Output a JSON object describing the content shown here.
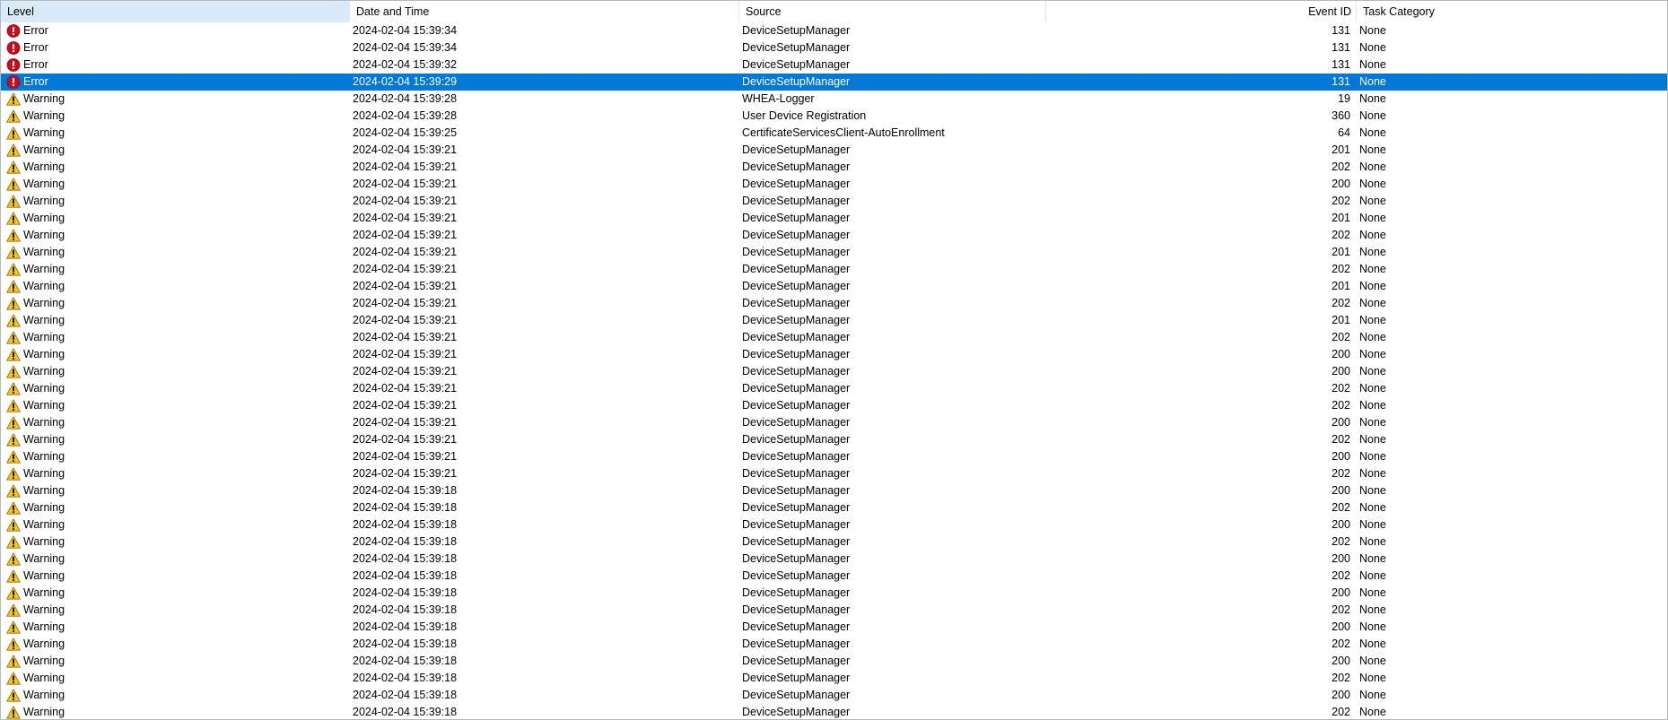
{
  "columns": {
    "level": "Level",
    "date": "Date and Time",
    "source": "Source",
    "event_id": "Event ID",
    "task": "Task Category"
  },
  "colors": {
    "selection": "#0078d7",
    "sorted_header": "#d9ebf9",
    "error_icon": "#c50f1f",
    "warning_icon": "#f7c325"
  },
  "selected_index": 3,
  "rows": [
    {
      "level": "Error",
      "icon": "error-icon",
      "date": "2024-02-04 15:39:34",
      "source": "DeviceSetupManager",
      "event_id": "131",
      "task": "None"
    },
    {
      "level": "Error",
      "icon": "error-icon",
      "date": "2024-02-04 15:39:34",
      "source": "DeviceSetupManager",
      "event_id": "131",
      "task": "None"
    },
    {
      "level": "Error",
      "icon": "error-icon",
      "date": "2024-02-04 15:39:32",
      "source": "DeviceSetupManager",
      "event_id": "131",
      "task": "None"
    },
    {
      "level": "Error",
      "icon": "error-icon",
      "date": "2024-02-04 15:39:29",
      "source": "DeviceSetupManager",
      "event_id": "131",
      "task": "None"
    },
    {
      "level": "Warning",
      "icon": "warning-icon",
      "date": "2024-02-04 15:39:28",
      "source": "WHEA-Logger",
      "event_id": "19",
      "task": "None"
    },
    {
      "level": "Warning",
      "icon": "warning-icon",
      "date": "2024-02-04 15:39:28",
      "source": "User Device Registration",
      "event_id": "360",
      "task": "None"
    },
    {
      "level": "Warning",
      "icon": "warning-icon",
      "date": "2024-02-04 15:39:25",
      "source": "CertificateServicesClient-AutoEnrollment",
      "event_id": "64",
      "task": "None"
    },
    {
      "level": "Warning",
      "icon": "warning-icon",
      "date": "2024-02-04 15:39:21",
      "source": "DeviceSetupManager",
      "event_id": "201",
      "task": "None"
    },
    {
      "level": "Warning",
      "icon": "warning-icon",
      "date": "2024-02-04 15:39:21",
      "source": "DeviceSetupManager",
      "event_id": "202",
      "task": "None"
    },
    {
      "level": "Warning",
      "icon": "warning-icon",
      "date": "2024-02-04 15:39:21",
      "source": "DeviceSetupManager",
      "event_id": "200",
      "task": "None"
    },
    {
      "level": "Warning",
      "icon": "warning-icon",
      "date": "2024-02-04 15:39:21",
      "source": "DeviceSetupManager",
      "event_id": "202",
      "task": "None"
    },
    {
      "level": "Warning",
      "icon": "warning-icon",
      "date": "2024-02-04 15:39:21",
      "source": "DeviceSetupManager",
      "event_id": "201",
      "task": "None"
    },
    {
      "level": "Warning",
      "icon": "warning-icon",
      "date": "2024-02-04 15:39:21",
      "source": "DeviceSetupManager",
      "event_id": "202",
      "task": "None"
    },
    {
      "level": "Warning",
      "icon": "warning-icon",
      "date": "2024-02-04 15:39:21",
      "source": "DeviceSetupManager",
      "event_id": "201",
      "task": "None"
    },
    {
      "level": "Warning",
      "icon": "warning-icon",
      "date": "2024-02-04 15:39:21",
      "source": "DeviceSetupManager",
      "event_id": "202",
      "task": "None"
    },
    {
      "level": "Warning",
      "icon": "warning-icon",
      "date": "2024-02-04 15:39:21",
      "source": "DeviceSetupManager",
      "event_id": "201",
      "task": "None"
    },
    {
      "level": "Warning",
      "icon": "warning-icon",
      "date": "2024-02-04 15:39:21",
      "source": "DeviceSetupManager",
      "event_id": "202",
      "task": "None"
    },
    {
      "level": "Warning",
      "icon": "warning-icon",
      "date": "2024-02-04 15:39:21",
      "source": "DeviceSetupManager",
      "event_id": "201",
      "task": "None"
    },
    {
      "level": "Warning",
      "icon": "warning-icon",
      "date": "2024-02-04 15:39:21",
      "source": "DeviceSetupManager",
      "event_id": "202",
      "task": "None"
    },
    {
      "level": "Warning",
      "icon": "warning-icon",
      "date": "2024-02-04 15:39:21",
      "source": "DeviceSetupManager",
      "event_id": "200",
      "task": "None"
    },
    {
      "level": "Warning",
      "icon": "warning-icon",
      "date": "2024-02-04 15:39:21",
      "source": "DeviceSetupManager",
      "event_id": "200",
      "task": "None"
    },
    {
      "level": "Warning",
      "icon": "warning-icon",
      "date": "2024-02-04 15:39:21",
      "source": "DeviceSetupManager",
      "event_id": "202",
      "task": "None"
    },
    {
      "level": "Warning",
      "icon": "warning-icon",
      "date": "2024-02-04 15:39:21",
      "source": "DeviceSetupManager",
      "event_id": "202",
      "task": "None"
    },
    {
      "level": "Warning",
      "icon": "warning-icon",
      "date": "2024-02-04 15:39:21",
      "source": "DeviceSetupManager",
      "event_id": "200",
      "task": "None"
    },
    {
      "level": "Warning",
      "icon": "warning-icon",
      "date": "2024-02-04 15:39:21",
      "source": "DeviceSetupManager",
      "event_id": "202",
      "task": "None"
    },
    {
      "level": "Warning",
      "icon": "warning-icon",
      "date": "2024-02-04 15:39:21",
      "source": "DeviceSetupManager",
      "event_id": "200",
      "task": "None"
    },
    {
      "level": "Warning",
      "icon": "warning-icon",
      "date": "2024-02-04 15:39:21",
      "source": "DeviceSetupManager",
      "event_id": "202",
      "task": "None"
    },
    {
      "level": "Warning",
      "icon": "warning-icon",
      "date": "2024-02-04 15:39:18",
      "source": "DeviceSetupManager",
      "event_id": "200",
      "task": "None"
    },
    {
      "level": "Warning",
      "icon": "warning-icon",
      "date": "2024-02-04 15:39:18",
      "source": "DeviceSetupManager",
      "event_id": "202",
      "task": "None"
    },
    {
      "level": "Warning",
      "icon": "warning-icon",
      "date": "2024-02-04 15:39:18",
      "source": "DeviceSetupManager",
      "event_id": "200",
      "task": "None"
    },
    {
      "level": "Warning",
      "icon": "warning-icon",
      "date": "2024-02-04 15:39:18",
      "source": "DeviceSetupManager",
      "event_id": "202",
      "task": "None"
    },
    {
      "level": "Warning",
      "icon": "warning-icon",
      "date": "2024-02-04 15:39:18",
      "source": "DeviceSetupManager",
      "event_id": "200",
      "task": "None"
    },
    {
      "level": "Warning",
      "icon": "warning-icon",
      "date": "2024-02-04 15:39:18",
      "source": "DeviceSetupManager",
      "event_id": "202",
      "task": "None"
    },
    {
      "level": "Warning",
      "icon": "warning-icon",
      "date": "2024-02-04 15:39:18",
      "source": "DeviceSetupManager",
      "event_id": "200",
      "task": "None"
    },
    {
      "level": "Warning",
      "icon": "warning-icon",
      "date": "2024-02-04 15:39:18",
      "source": "DeviceSetupManager",
      "event_id": "202",
      "task": "None"
    },
    {
      "level": "Warning",
      "icon": "warning-icon",
      "date": "2024-02-04 15:39:18",
      "source": "DeviceSetupManager",
      "event_id": "200",
      "task": "None"
    },
    {
      "level": "Warning",
      "icon": "warning-icon",
      "date": "2024-02-04 15:39:18",
      "source": "DeviceSetupManager",
      "event_id": "202",
      "task": "None"
    },
    {
      "level": "Warning",
      "icon": "warning-icon",
      "date": "2024-02-04 15:39:18",
      "source": "DeviceSetupManager",
      "event_id": "200",
      "task": "None"
    },
    {
      "level": "Warning",
      "icon": "warning-icon",
      "date": "2024-02-04 15:39:18",
      "source": "DeviceSetupManager",
      "event_id": "202",
      "task": "None"
    },
    {
      "level": "Warning",
      "icon": "warning-icon",
      "date": "2024-02-04 15:39:18",
      "source": "DeviceSetupManager",
      "event_id": "200",
      "task": "None"
    },
    {
      "level": "Warning",
      "icon": "warning-icon",
      "date": "2024-02-04 15:39:18",
      "source": "DeviceSetupManager",
      "event_id": "202",
      "task": "None"
    }
  ]
}
